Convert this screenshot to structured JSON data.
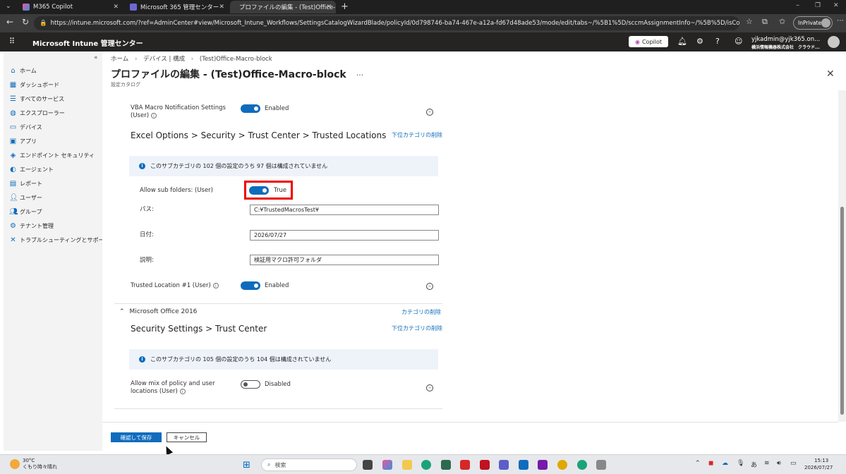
{
  "tabs": [
    {
      "label": "M365 Copilot",
      "icon": "copilot-icon"
    },
    {
      "label": "Microsoft 365 管理センター",
      "icon": "admin-center-icon"
    },
    {
      "label": "プロファイルの編集 - (Test)Office-Ma",
      "icon": "intune-icon",
      "active": true
    }
  ],
  "browser": {
    "url": "https://intune.microsoft.com/?ref=AdminCenter#view/Microsoft_Intune_Workflows/SettingsCatalogWizardBlade/policyId/0d798746-ba74-467e-a12a-fd67d48ade53/mode/edit/tabs~/%5B1%5D/sccmAssignmentInfo~/%5B%5D/isCompliance~/false/cat...",
    "inprivate": "InPrivate"
  },
  "header": {
    "title": "Microsoft Intune 管理センター",
    "copilot": "Copilot",
    "account_email": "yjkadmin@yjk365.on...",
    "account_org": "横浜情報機器株式会社　クラウド..."
  },
  "sidebar": {
    "items": [
      {
        "label": "ホーム",
        "icon": "home-icon"
      },
      {
        "label": "ダッシュボード",
        "icon": "dashboard-icon"
      },
      {
        "label": "すべてのサービス",
        "icon": "all-services-icon"
      },
      {
        "label": "エクスプローラー",
        "icon": "explorer-icon"
      },
      {
        "label": "デバイス",
        "icon": "devices-icon"
      },
      {
        "label": "アプリ",
        "icon": "apps-icon"
      },
      {
        "label": "エンドポイント セキュリティ",
        "icon": "endpoint-security-icon"
      },
      {
        "label": "エージェント",
        "icon": "agent-icon"
      },
      {
        "label": "レポート",
        "icon": "reports-icon"
      },
      {
        "label": "ユーザー",
        "icon": "users-icon"
      },
      {
        "label": "グループ",
        "icon": "groups-icon"
      },
      {
        "label": "テナント管理",
        "icon": "tenant-admin-icon"
      },
      {
        "label": "トラブルシューティングとサポート",
        "icon": "troubleshoot-icon"
      }
    ]
  },
  "page": {
    "breadcrumb": [
      "ホーム",
      "デバイス | 構成",
      "(Test)Office-Macro-block"
    ],
    "title": "プロファイルの編集 - (Test)Office-Macro-block",
    "subtitle": "設定カタログ"
  },
  "settings": {
    "vba_label": "VBA Macro Notification Settings (User)",
    "vba_label_1": "VBA Macro Notification Settings",
    "vba_label_2": "(User)",
    "vba_state": "Enabled",
    "section1_title": "Excel Options > Security > Trust Center > Trusted Locations",
    "section1_remove": "下位カテゴリの削除",
    "section1_info": "このサブカテゴリの 102 個の設定のうち 97 個は構成されていません",
    "allow_sub_label": "Allow sub folders: (User)",
    "allow_sub_state": "True",
    "path_label": "パス:",
    "path_value": "C:¥TrustedMacrosTest¥",
    "date_label": "日付:",
    "date_value": "2026/07/27",
    "desc_label": "説明:",
    "desc_value": "検証用マクロ許可フォルダ",
    "trusted_loc_label": "Trusted Location #1 (User)",
    "trusted_loc_state": "Enabled",
    "category2": "Microsoft Office 2016",
    "category2_remove": "カテゴリの削除",
    "section2_title": "Security Settings > Trust Center",
    "section2_remove": "下位カテゴリの削除",
    "section2_info": "このサブカテゴリの 105 個の設定のうち 104 個は構成されていません",
    "allow_mix_label_1": "Allow mix of policy and user",
    "allow_mix_label_2": "locations (User)",
    "allow_mix_state": "Disabled"
  },
  "footer": {
    "save": "確認して保存",
    "cancel": "キャンセル"
  },
  "taskbar": {
    "weather_temp": "30°C",
    "weather_desc": "くもり時々晴れ",
    "search": "検索",
    "time": "15:13",
    "date": "2026/07/27",
    "ime": "あ"
  },
  "colors": {
    "accent": "#0f6cbd",
    "highlight_box": "#e00000"
  }
}
